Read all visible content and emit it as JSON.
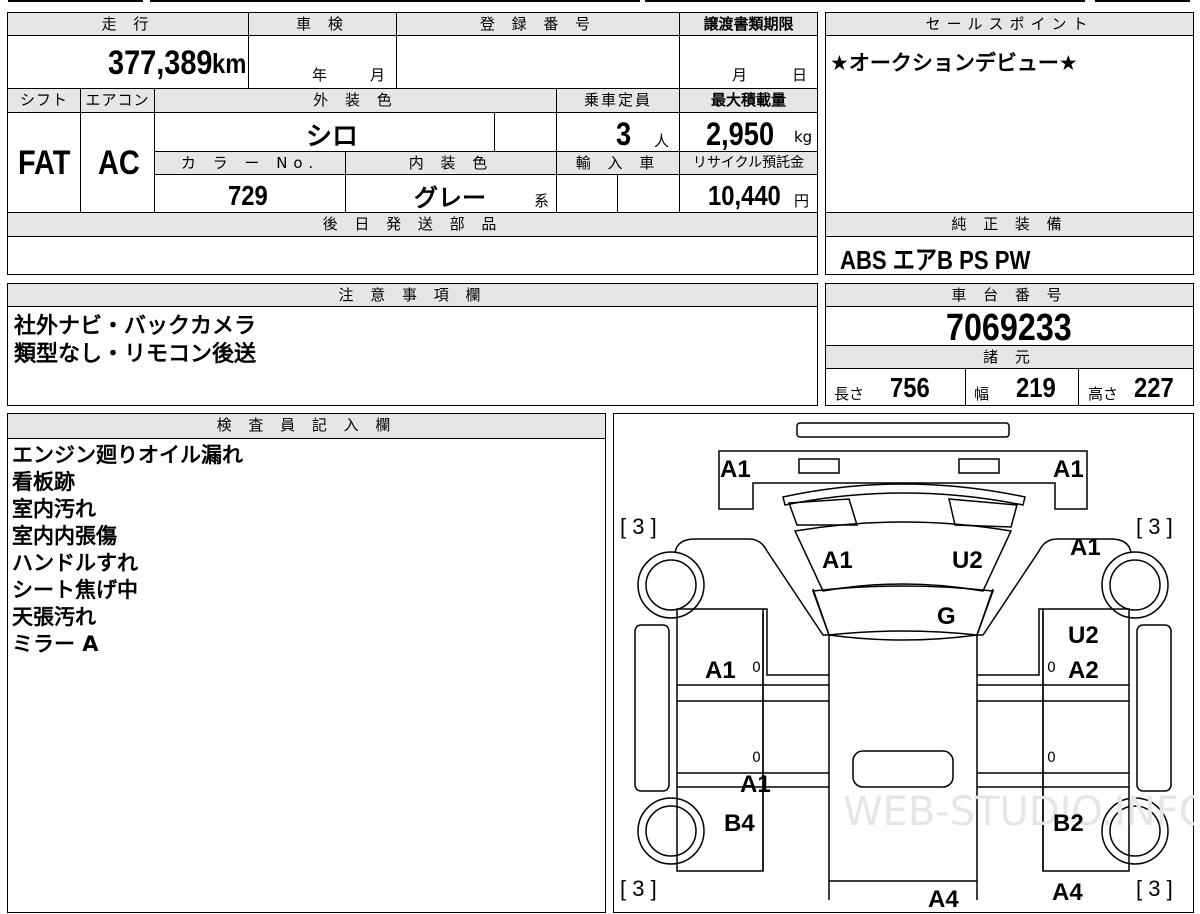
{
  "top_section": {
    "mileage_header": "走 行",
    "mileage_value": "377,389",
    "mileage_unit": "km",
    "inspection_header": "車 検",
    "inspection_year": "年",
    "inspection_month": "月",
    "registration_header": "登 録 番 号",
    "transfer_deadline_header": "譲渡書類期限",
    "transfer_month": "月",
    "transfer_day": "日",
    "shift_header": "シフト",
    "shift_value": "FAT",
    "aircon_header": "エアコン",
    "aircon_value": "AC",
    "exterior_color_header": "外 装 色",
    "exterior_color_value": "シロ",
    "capacity_header": "乗車定員",
    "capacity_value": "3",
    "capacity_unit": "人",
    "max_load_header": "最大積載量",
    "max_load_value": "2,950",
    "max_load_unit": "kg",
    "color_no_header": "カ ラ ー No.",
    "color_no_value": "729",
    "interior_color_header": "内 装 色",
    "interior_color_value": "グレー",
    "interior_color_suffix": "系",
    "import_header": "輸 入 車",
    "recycle_fee_header": "リサイクル預託金",
    "recycle_fee_value": "10,440",
    "recycle_fee_unit": "円",
    "later_parts_header": "後 日 発 送 部 品"
  },
  "sales_point": {
    "header": "セールスポイント",
    "text": "★オークションデビュー★"
  },
  "genuine_equipment": {
    "header": "純 正 装 備",
    "text": "ABS エアB PS PW"
  },
  "notes": {
    "header": "注 意 事 項 欄",
    "lines": [
      "社外ナビ・バックカメラ",
      "類型なし・リモコン後送"
    ]
  },
  "chassis": {
    "header": "車 台 番 号",
    "number": "7069233",
    "specs_header": "諸 元",
    "length_label": "長さ",
    "length_value": "756",
    "width_label": "幅",
    "width_value": "219",
    "height_label": "高さ",
    "height_value": "227"
  },
  "inspector": {
    "header": "検 査 員 記 入 欄",
    "lines": [
      "エンジン廻りオイル漏れ",
      "看板跡",
      "室内汚れ",
      "室内内張傷",
      "ハンドルすれ",
      "シート焦げ中",
      "天張汚れ",
      "ミラー A"
    ]
  },
  "diagram": {
    "marks": {
      "front_left_top": "A1",
      "front_right_top": "A1",
      "tire_fl_bracket": "[ 3 ]",
      "tire_fr_bracket": "[ 3 ]",
      "windshield_left": "A1",
      "windshield_right": "U2",
      "fender_right": "A1",
      "hood_center": "G",
      "right_door_upper": "U2",
      "right_door": "A2",
      "left_door": "A1",
      "left_lower": "A1",
      "rear_left": "B4",
      "rear_right": "B2",
      "tire_rl_bracket": "[ 3 ]",
      "tire_rr_bracket": "[ 3 ]",
      "rear_right_bottom": "A4",
      "rear_center_bottom": "A4",
      "zero": "0"
    },
    "watermark": "WEB-STUDIO.INFO"
  }
}
